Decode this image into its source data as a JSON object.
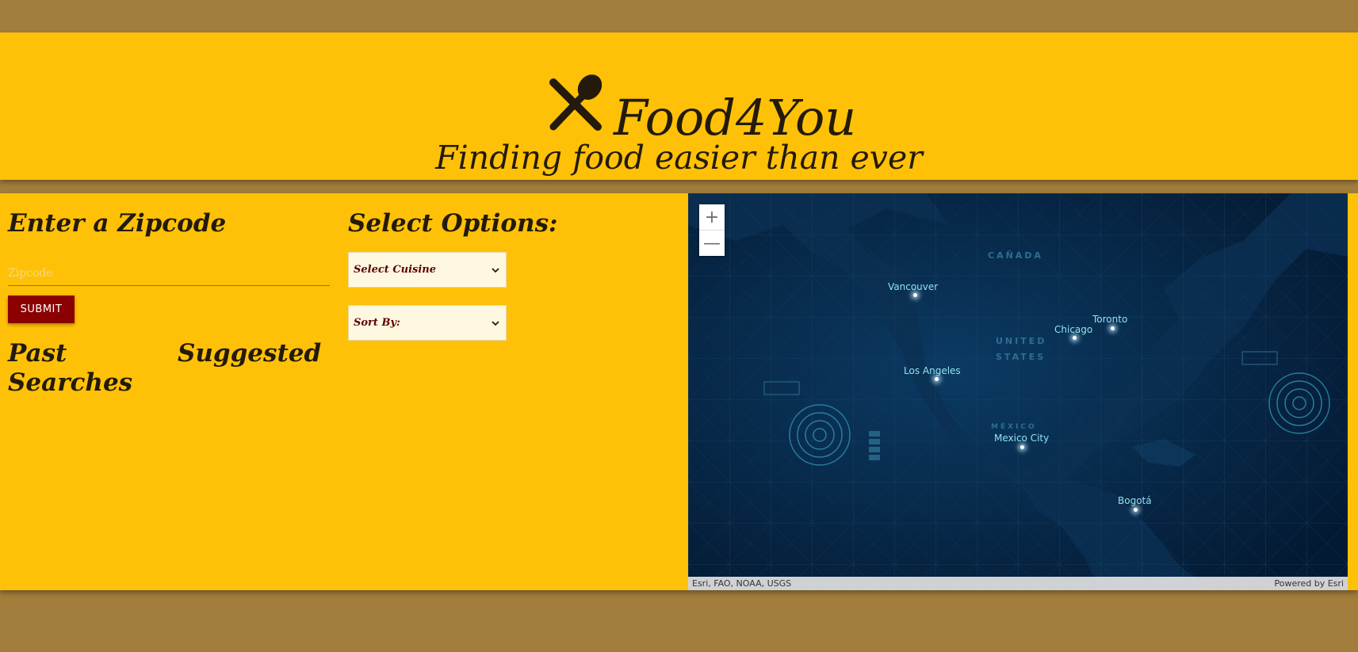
{
  "header": {
    "title": "Food4You",
    "tagline": "Finding food easier than ever",
    "logo_icon": "fork-spoon-icon"
  },
  "search": {
    "heading": "Enter a Zipcode",
    "placeholder": "Zipcode",
    "value": "",
    "submit_label": "SUBMIT"
  },
  "history": {
    "past_label": "Past Searches",
    "suggested_label": "Suggested"
  },
  "options": {
    "heading": "Select Options:",
    "cuisine_selected": "Select Cuisine",
    "sort_selected": "Sort By:"
  },
  "map": {
    "zoom_in": "+",
    "zoom_out": "—",
    "attribution": "Esri, FAO, NOAA, USGS",
    "powered_by": "Powered by Esri",
    "regions": [
      "CAÑADA",
      "UNITED",
      "STATES",
      "MÉXICO"
    ],
    "cities": [
      "Vancouver",
      "Toronto",
      "Chicago",
      "Los Angeles",
      "Mexico City",
      "Bogotá"
    ]
  },
  "colors": {
    "page_background": "#a27d3b",
    "panel": "#ffc107",
    "button": "#8b0000",
    "map_background": "#062544"
  }
}
